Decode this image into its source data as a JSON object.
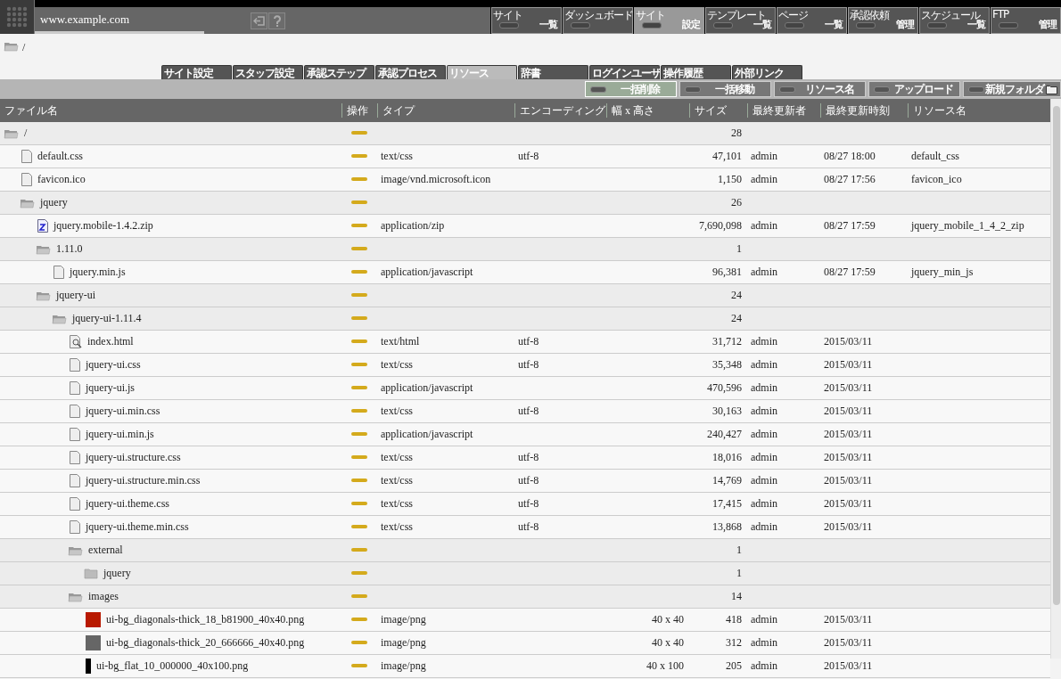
{
  "header": {
    "site": "www.example.com"
  },
  "nav": [
    {
      "label": "サイト",
      "sub": "一覧",
      "selected": false
    },
    {
      "label": "ダッシュボード",
      "selected": false
    },
    {
      "label": "サイト",
      "sub": "設定",
      "selected": true
    },
    {
      "label": "テンプレート",
      "sub": "一覧",
      "selected": false
    },
    {
      "label": "ページ",
      "sub": "一覧",
      "selected": false
    },
    {
      "label": "承認依頼",
      "sub": "管理",
      "selected": false
    },
    {
      "label": "スケジュール",
      "sub": "一覧",
      "selected": false
    },
    {
      "label": "FTP",
      "sub": "管理",
      "selected": false
    }
  ],
  "breadcrumb": "/",
  "tabs": [
    {
      "label": "サイト設定",
      "selected": false
    },
    {
      "label": "スタッフ設定",
      "selected": false
    },
    {
      "label": "承認ステップ",
      "selected": false
    },
    {
      "label": "承認プロセス",
      "selected": false
    },
    {
      "label": "リソース",
      "selected": true
    },
    {
      "label": "辞書",
      "selected": false
    },
    {
      "label": "ログインユーザ",
      "selected": false
    },
    {
      "label": "操作履歴",
      "selected": false
    },
    {
      "label": "外部リンク",
      "selected": false
    }
  ],
  "toolbar": [
    {
      "label": "一括削除",
      "active": true
    },
    {
      "label": "一括移動",
      "active": false
    },
    {
      "label": "リソース名",
      "active": false
    },
    {
      "label": "アップロード",
      "active": false
    },
    {
      "label": "新規フォルダ",
      "active": false
    }
  ],
  "table": {
    "columns": [
      "ファイル名",
      "操作",
      "タイプ",
      "エンコーディング",
      "幅 x 高さ",
      "サイズ",
      "最終更新者",
      "最終更新時刻",
      "リソース名"
    ],
    "rows": [
      {
        "kind": "folder",
        "expanded": true,
        "name": "/",
        "size": "28",
        "children": [
          {
            "kind": "file",
            "name": "default.css",
            "type": "text/css",
            "encoding": "utf-8",
            "size": "47,101",
            "updater": "admin",
            "updated": "08/27 18:00",
            "resource": "default_css"
          },
          {
            "kind": "file",
            "name": "favicon.ico",
            "type": "image/vnd.microsoft.icon",
            "size": "1,150",
            "updater": "admin",
            "updated": "08/27 17:56",
            "resource": "favicon_ico"
          },
          {
            "kind": "folder",
            "expanded": true,
            "name": "jquery",
            "size": "26",
            "children": [
              {
                "kind": "zip",
                "name": "jquery.mobile-1.4.2.zip",
                "type": "application/zip",
                "size": "7,690,098",
                "updater": "admin",
                "updated": "08/27 17:59",
                "resource": "jquery_mobile_1_4_2_zip"
              },
              {
                "kind": "folder",
                "expanded": true,
                "name": "1.11.0",
                "size": "1",
                "children": [
                  {
                    "kind": "file",
                    "name": "jquery.min.js",
                    "type": "application/javascript",
                    "size": "96,381",
                    "updater": "admin",
                    "updated": "08/27 17:59",
                    "resource": "jquery_min_js"
                  }
                ]
              },
              {
                "kind": "folder",
                "expanded": true,
                "name": "jquery-ui",
                "size": "24",
                "children": [
                  {
                    "kind": "folder",
                    "expanded": true,
                    "name": "jquery-ui-1.11.4",
                    "size": "24",
                    "children": [
                      {
                        "kind": "html",
                        "name": "index.html",
                        "type": "text/html",
                        "encoding": "utf-8",
                        "size": "31,712",
                        "updater": "admin",
                        "updated": "2015/03/11"
                      },
                      {
                        "kind": "file",
                        "name": "jquery-ui.css",
                        "type": "text/css",
                        "encoding": "utf-8",
                        "size": "35,348",
                        "updater": "admin",
                        "updated": "2015/03/11"
                      },
                      {
                        "kind": "file",
                        "name": "jquery-ui.js",
                        "type": "application/javascript",
                        "size": "470,596",
                        "updater": "admin",
                        "updated": "2015/03/11"
                      },
                      {
                        "kind": "file",
                        "name": "jquery-ui.min.css",
                        "type": "text/css",
                        "encoding": "utf-8",
                        "size": "30,163",
                        "updater": "admin",
                        "updated": "2015/03/11"
                      },
                      {
                        "kind": "file",
                        "name": "jquery-ui.min.js",
                        "type": "application/javascript",
                        "size": "240,427",
                        "updater": "admin",
                        "updated": "2015/03/11"
                      },
                      {
                        "kind": "file",
                        "name": "jquery-ui.structure.css",
                        "type": "text/css",
                        "encoding": "utf-8",
                        "size": "18,016",
                        "updater": "admin",
                        "updated": "2015/03/11"
                      },
                      {
                        "kind": "file",
                        "name": "jquery-ui.structure.min.css",
                        "type": "text/css",
                        "encoding": "utf-8",
                        "size": "14,769",
                        "updater": "admin",
                        "updated": "2015/03/11"
                      },
                      {
                        "kind": "file",
                        "name": "jquery-ui.theme.css",
                        "type": "text/css",
                        "encoding": "utf-8",
                        "size": "17,415",
                        "updater": "admin",
                        "updated": "2015/03/11"
                      },
                      {
                        "kind": "file",
                        "name": "jquery-ui.theme.min.css",
                        "type": "text/css",
                        "encoding": "utf-8",
                        "size": "13,868",
                        "updater": "admin",
                        "updated": "2015/03/11"
                      },
                      {
                        "kind": "folder",
                        "expanded": true,
                        "name": "external",
                        "size": "1",
                        "children": [
                          {
                            "kind": "folder",
                            "expanded": false,
                            "name": "jquery",
                            "size": "1"
                          }
                        ]
                      },
                      {
                        "kind": "folder",
                        "expanded": true,
                        "name": "images",
                        "size": "14",
                        "children": [
                          {
                            "kind": "thumb",
                            "color": "#b81900",
                            "name": "ui-bg_diagonals-thick_18_b81900_40x40.png",
                            "type": "image/png",
                            "dimensions": "40 x 40",
                            "size": "418",
                            "updater": "admin",
                            "updated": "2015/03/11"
                          },
                          {
                            "kind": "thumb",
                            "color": "#666666",
                            "name": "ui-bg_diagonals-thick_20_666666_40x40.png",
                            "type": "image/png",
                            "dimensions": "40 x 40",
                            "size": "312",
                            "updater": "admin",
                            "updated": "2015/03/11"
                          },
                          {
                            "kind": "strip",
                            "color": "#000000",
                            "name": "ui-bg_flat_10_000000_40x100.png",
                            "type": "image/png",
                            "dimensions": "40 x 100",
                            "size": "205",
                            "updater": "admin",
                            "updated": "2015/03/11"
                          }
                        ]
                      }
                    ]
                  }
                ]
              }
            ]
          }
        ]
      }
    ]
  }
}
